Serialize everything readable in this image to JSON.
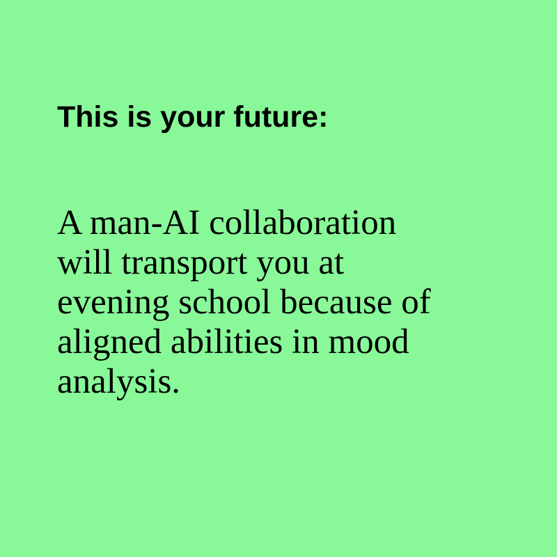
{
  "colors": {
    "background": "#88f898",
    "text": "#000000"
  },
  "heading": "This is your future:",
  "body_lines": [
    "A man-AI collaboration",
    "will transport you at",
    "evening school because of",
    "aligned abilities in mood",
    "analysis."
  ]
}
